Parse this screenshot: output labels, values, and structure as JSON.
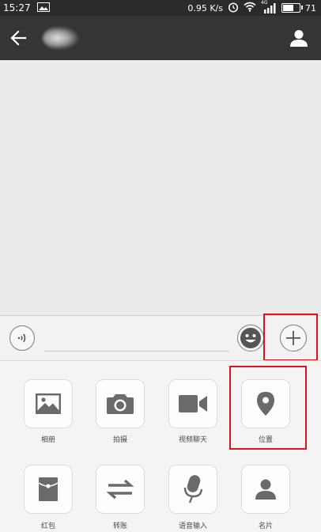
{
  "status_bar": {
    "time": "15:27",
    "speed": "0.95 K/s",
    "network": "4G",
    "battery": "71",
    "battery_level": 0.71
  },
  "header": {
    "contact_name": ""
  },
  "input_bar": {
    "text_value": ""
  },
  "panel": {
    "items": [
      {
        "label": "相册",
        "icon": "photo-icon"
      },
      {
        "label": "拍摄",
        "icon": "camera-icon"
      },
      {
        "label": "视频聊天",
        "icon": "video-camera-icon"
      },
      {
        "label": "位置",
        "icon": "location-pin-icon"
      },
      {
        "label": "红包",
        "icon": "red-envelope-icon"
      },
      {
        "label": "转账",
        "icon": "transfer-arrows-icon"
      },
      {
        "label": "语音输入",
        "icon": "microphone-icon"
      },
      {
        "label": "名片",
        "icon": "contact-card-icon"
      }
    ]
  },
  "colors": {
    "header_bg": "#353538",
    "status_bg": "#2b2b2d",
    "highlight": "#d8151d",
    "icon_gray": "#6a6a6a"
  }
}
